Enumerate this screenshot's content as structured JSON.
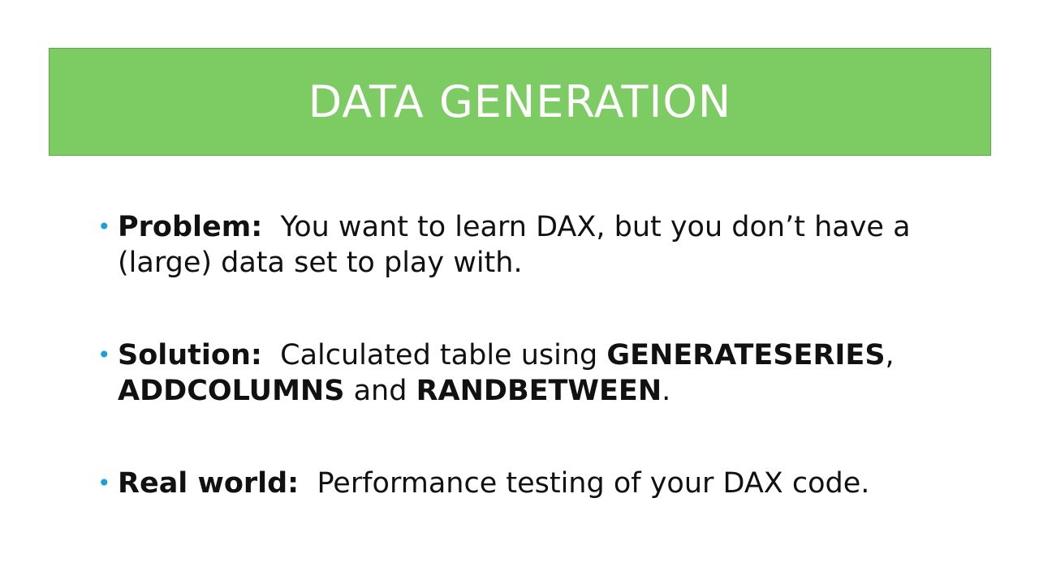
{
  "slide": {
    "title": "DATA GENERATION",
    "bullet_glyph": "•",
    "accent_color": "#7dcb63",
    "bullet_color": "#1c9fd8"
  },
  "bullets": [
    {
      "label": "Problem:",
      "line1": "You want to learn DAX, but you don’t have a",
      "line2": "(large) data set to play with."
    },
    {
      "label": "Solution:",
      "text_before": "Calculated table using",
      "func1": "GENERATESERIES",
      "comma": ",",
      "func2": "ADDCOLUMNS",
      "and": "and",
      "func3": "RANDBETWEEN",
      "period": "."
    },
    {
      "label": "Real world:",
      "text": "Performance testing of your DAX code."
    }
  ]
}
